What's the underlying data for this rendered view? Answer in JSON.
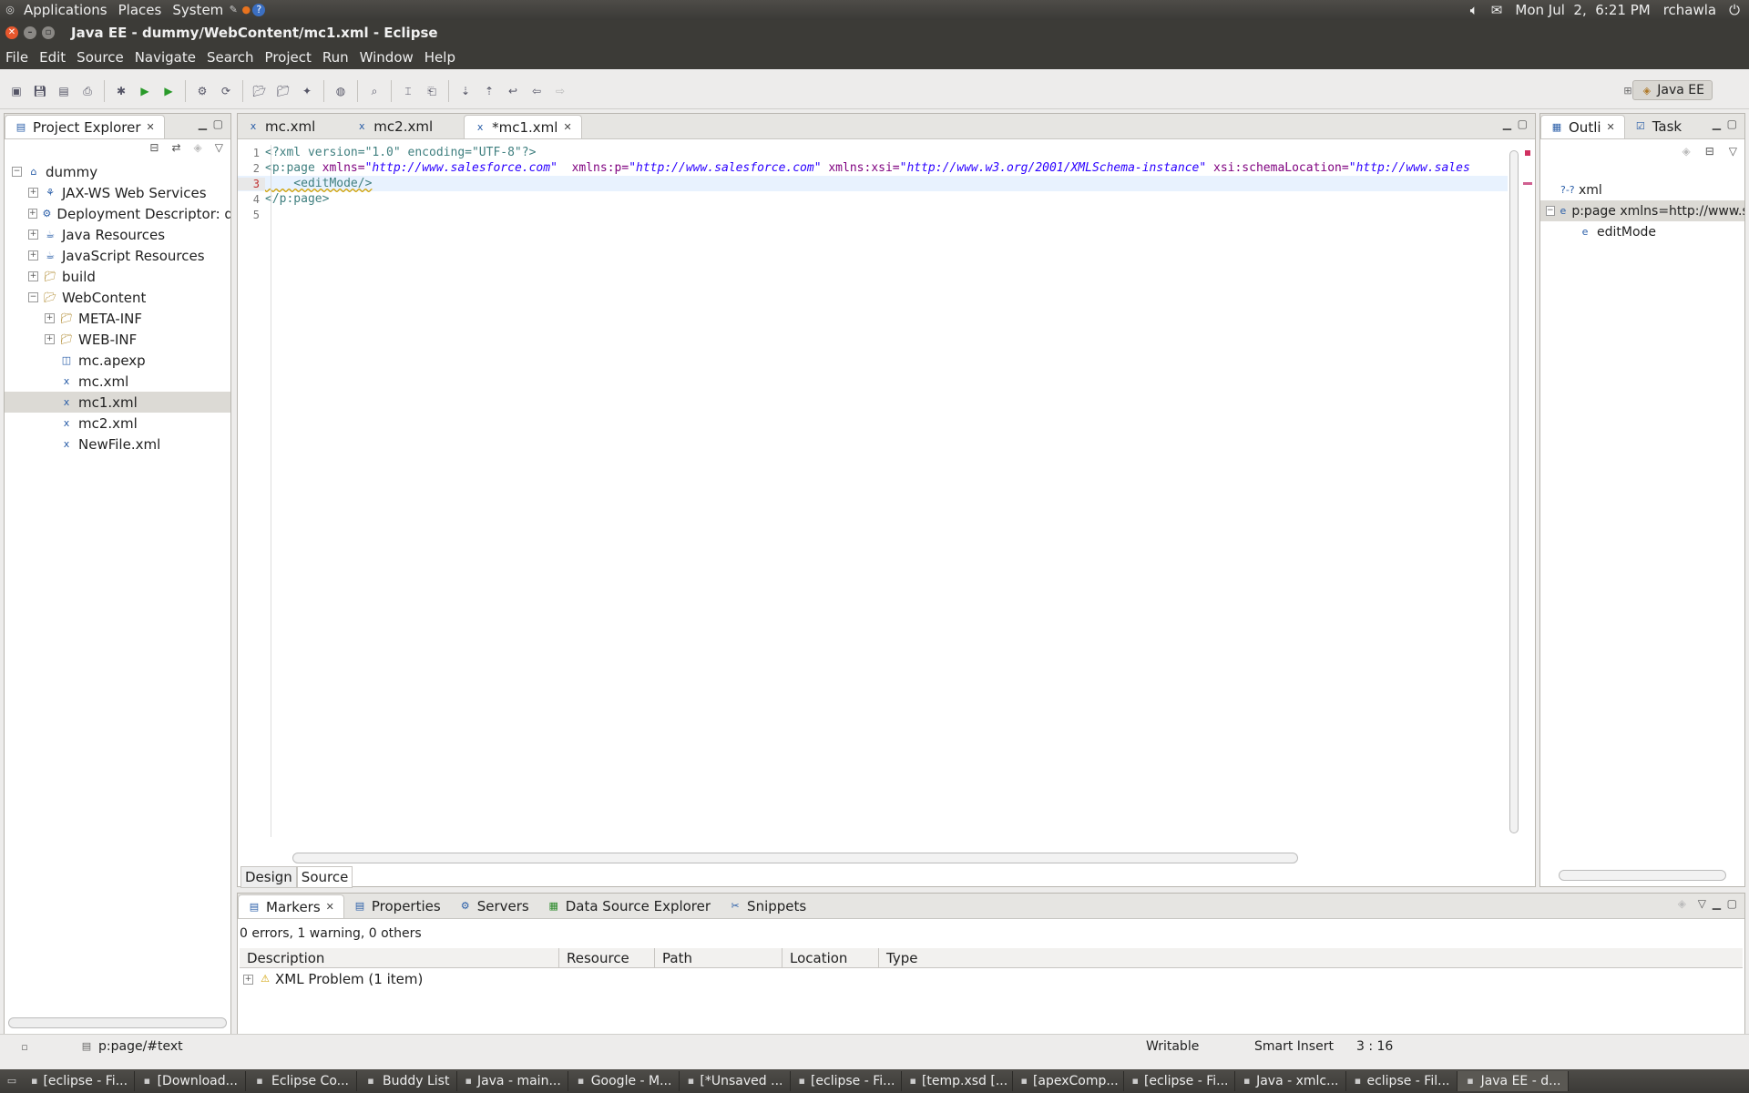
{
  "topbar": {
    "menus": [
      "Applications",
      "Places",
      "System"
    ],
    "datetime": "Mon Jul  2,  6:21 PM",
    "user": "rchawla"
  },
  "window": {
    "title": "Java EE - dummy/WebContent/mc1.xml - Eclipse"
  },
  "menubar": [
    "File",
    "Edit",
    "Source",
    "Navigate",
    "Search",
    "Project",
    "Run",
    "Window",
    "Help"
  ],
  "perspective": {
    "label": "Java EE"
  },
  "project_explorer": {
    "title": "Project Explorer",
    "items": [
      {
        "label": "dummy",
        "indent": 0,
        "expander": "−",
        "icon": "project-icon"
      },
      {
        "label": "JAX-WS Web Services",
        "indent": 1,
        "expander": "+",
        "icon": "webservice-icon"
      },
      {
        "label": "Deployment Descriptor: dum",
        "indent": 1,
        "expander": "+",
        "icon": "descriptor-icon"
      },
      {
        "label": "Java Resources",
        "indent": 1,
        "expander": "+",
        "icon": "java-resources-icon"
      },
      {
        "label": "JavaScript Resources",
        "indent": 1,
        "expander": "+",
        "icon": "js-resources-icon"
      },
      {
        "label": "build",
        "indent": 1,
        "expander": "+",
        "icon": "folder-icon"
      },
      {
        "label": "WebContent",
        "indent": 1,
        "expander": "−",
        "icon": "folder-open-icon"
      },
      {
        "label": "META-INF",
        "indent": 2,
        "expander": "+",
        "icon": "folder-icon"
      },
      {
        "label": "WEB-INF",
        "indent": 2,
        "expander": "+",
        "icon": "folder-icon"
      },
      {
        "label": "mc.apexp",
        "indent": 2,
        "expander": "",
        "icon": "file-icon"
      },
      {
        "label": "mc.xml",
        "indent": 2,
        "expander": "",
        "icon": "xml-file-icon"
      },
      {
        "label": "mc1.xml",
        "indent": 2,
        "expander": "",
        "icon": "xml-file-icon",
        "selected": true
      },
      {
        "label": "mc2.xml",
        "indent": 2,
        "expander": "",
        "icon": "xml-file-icon"
      },
      {
        "label": "NewFile.xml",
        "indent": 2,
        "expander": "",
        "icon": "xml-file-icon"
      }
    ]
  },
  "editor": {
    "tabs": [
      {
        "label": "mc.xml",
        "active": false
      },
      {
        "label": "mc2.xml",
        "active": false
      },
      {
        "label": "*mc1.xml",
        "active": true
      }
    ],
    "line_numbers": [
      "1",
      "2",
      "3",
      "4",
      "5"
    ],
    "lines": {
      "l1": "<?xml version=\"1.0\" encoding=\"UTF-8\"?>",
      "l2_tag": "<p:page",
      "l2_a1": " xmlns=",
      "l2_v1": "\"http://www.salesforce.com\"",
      "l2_a2": "  xmlns:p=",
      "l2_v2": "\"http://www.salesforce.com\"",
      "l2_a3": " xmlns:xsi=",
      "l2_v3": "\"http://www.w3.org/2001/XMLSchema-instance\"",
      "l2_a4": " xsi:schemaLocation=",
      "l2_v4": "\"http://www.sales",
      "l3": "    <editMode/>",
      "l4": "</p:page>"
    },
    "bottom_tabs": [
      "Design",
      "Source"
    ]
  },
  "outline": {
    "tabs": [
      "Outli",
      "Task"
    ],
    "items": [
      {
        "label": "xml",
        "icon": "pi-icon"
      },
      {
        "label": "p:page xmlns=http://www.s",
        "icon": "element-icon"
      },
      {
        "label": "editMode",
        "icon": "element-icon"
      }
    ]
  },
  "markers": {
    "tabs": [
      "Markers",
      "Properties",
      "Servers",
      "Data Source Explorer",
      "Snippets"
    ],
    "summary": "0 errors, 1 warning, 0 others",
    "columns": [
      "Description",
      "Resource",
      "Path",
      "Location",
      "Type"
    ],
    "rows": [
      {
        "description": "XML Problem (1 item)"
      }
    ]
  },
  "status": {
    "path": "p:page/#text",
    "writable": "Writable",
    "insert_mode": "Smart Insert",
    "position": "3 : 16"
  },
  "taskbar": [
    "[eclipse - Fi...",
    "[Download...",
    "Eclipse Co...",
    "Buddy List",
    "Java - main...",
    "Google - M...",
    "[*Unsaved ...",
    "[eclipse - Fi...",
    "[temp.xsd [...",
    "[apexComp...",
    "[eclipse - Fi...",
    "Java - xmlc...",
    "eclipse - Fil...",
    "Java EE - d..."
  ]
}
